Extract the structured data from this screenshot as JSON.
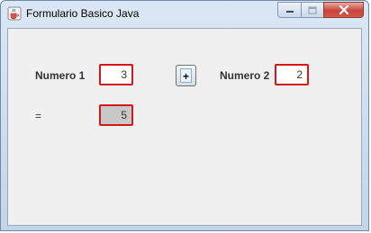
{
  "window": {
    "title": "Formulario Basico Java",
    "icon": "java-cup-icon"
  },
  "form": {
    "numero1_label": "Numero 1",
    "numero1_value": "3",
    "operator_label": "+",
    "numero2_label": "Numero 2",
    "numero2_value": "2",
    "equals_label": "=",
    "result_value": "5"
  },
  "colors": {
    "field_border": "#d41818",
    "result_background": "#c8c8c8"
  }
}
